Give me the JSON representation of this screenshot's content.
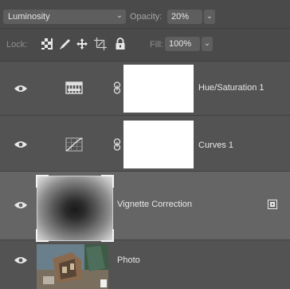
{
  "toolbar": {
    "blend_mode": "Luminosity",
    "opacity_label": "Opacity:",
    "opacity_value": "20%",
    "lock_label": "Lock:",
    "fill_label": "Fill:",
    "fill_value": "100%"
  },
  "layers": [
    {
      "name": "Hue/Saturation 1",
      "type": "adjustment",
      "icon": "hue-saturation-icon",
      "has_mask": true,
      "linked": true,
      "visible": true
    },
    {
      "name": "Curves 1",
      "type": "adjustment",
      "icon": "curves-icon",
      "has_mask": true,
      "linked": true,
      "visible": true
    },
    {
      "name": "Vignette Correction",
      "type": "smart-object",
      "selected": true,
      "visible": true
    },
    {
      "name": "Photo",
      "type": "smart-object",
      "visible": true
    }
  ],
  "colors": {
    "panel": "#535353",
    "selected_row": "#656565",
    "toolbar": "#4a4a4a"
  }
}
